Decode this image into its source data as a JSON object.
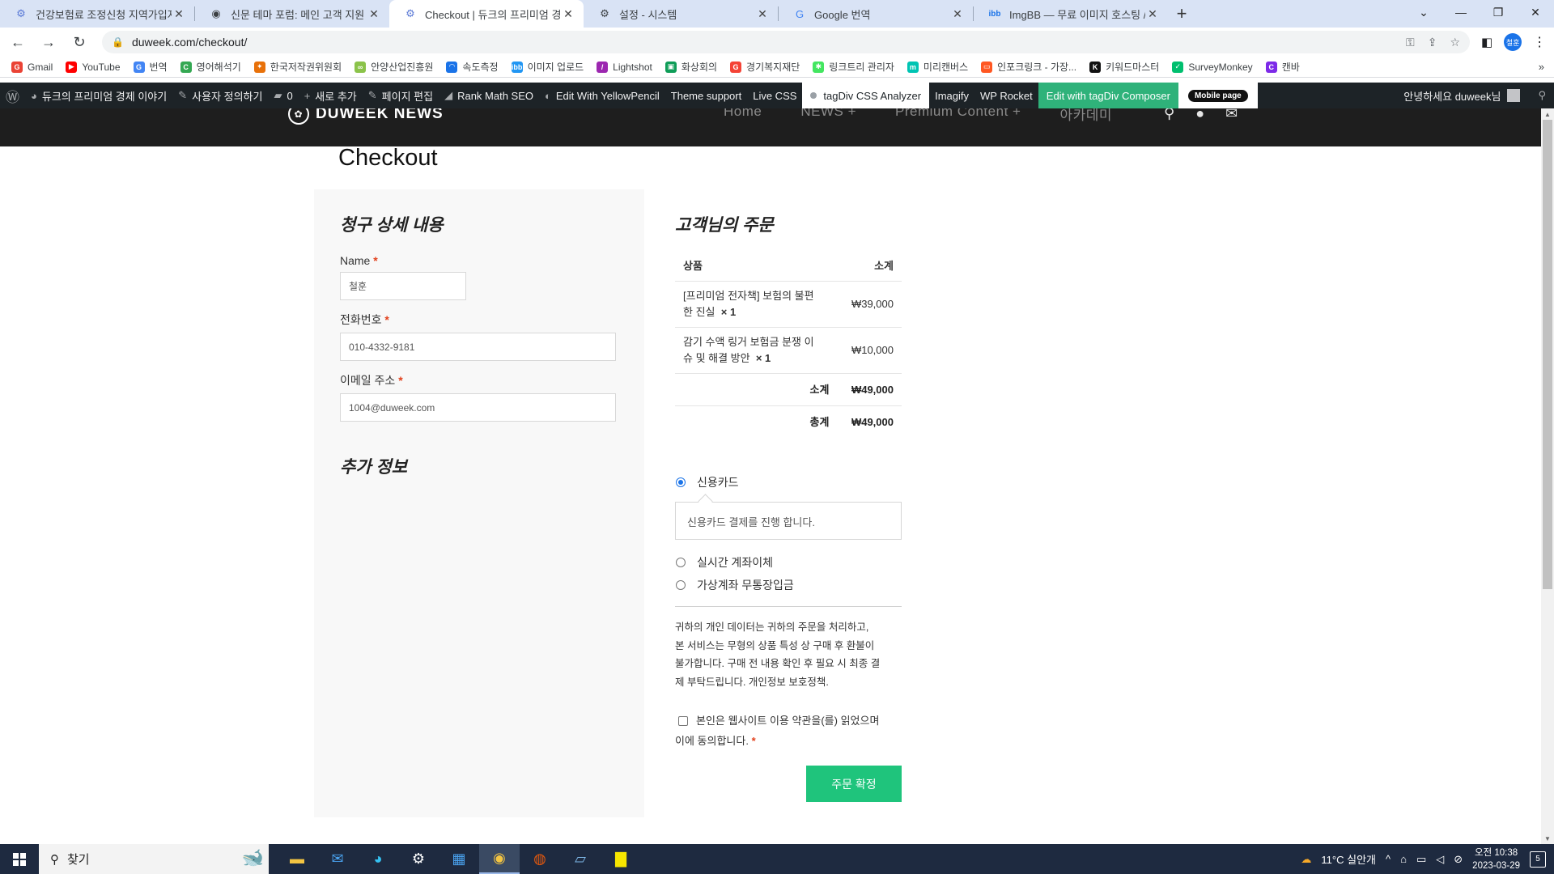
{
  "browser": {
    "tabs": [
      {
        "title": "건강보험료 조정신청 지역가입자",
        "icon": "gear-blue-icon",
        "active": false
      },
      {
        "title": "신문 테마 포럼: 메인 고객 지원",
        "icon": "eye-icon",
        "active": false
      },
      {
        "title": "Checkout | 듀크의 프리미엄 경제",
        "icon": "gear-blue-icon",
        "active": true
      },
      {
        "title": "설정 - 시스템",
        "icon": "gear-icon",
        "active": false
      },
      {
        "title": "Google 번역",
        "icon": "translate-icon",
        "active": false
      },
      {
        "title": "ImgBB — 무료 이미지 호스팅 /",
        "icon": "imgbb-icon",
        "active": false
      }
    ],
    "url": "duweek.com/checkout/",
    "profile_initials": "철훈",
    "bookmarks": [
      {
        "label": "Gmail",
        "color": "#ea4335",
        "glyph": "G"
      },
      {
        "label": "YouTube",
        "color": "#ff0000",
        "glyph": "▶"
      },
      {
        "label": "번역",
        "color": "#4285f4",
        "glyph": "G"
      },
      {
        "label": "영어해석기",
        "color": "#34a853",
        "glyph": "C"
      },
      {
        "label": "한국저작권위원회",
        "color": "#e8710a",
        "glyph": "✦"
      },
      {
        "label": "안양산업진흥원",
        "color": "#8bc34a",
        "glyph": "∞"
      },
      {
        "label": "속도측정",
        "color": "#1a73e8",
        "glyph": "◠"
      },
      {
        "label": "이미지 업로드",
        "color": "#2196f3",
        "glyph": "ibb"
      },
      {
        "label": "Lightshot",
        "color": "#9c27b0",
        "glyph": "/"
      },
      {
        "label": "화상회의",
        "color": "#0f9d58",
        "glyph": "▣"
      },
      {
        "label": "경기복지재단",
        "color": "#f44336",
        "glyph": "G"
      },
      {
        "label": "링크트리 관리자",
        "color": "#43e660",
        "glyph": "✱"
      },
      {
        "label": "미리캔버스",
        "color": "#00c4b3",
        "glyph": "m"
      },
      {
        "label": "인포크링크 - 가장...",
        "color": "#ff5722",
        "glyph": "▭"
      },
      {
        "label": "키워드마스터",
        "color": "#111111",
        "glyph": "K"
      },
      {
        "label": "SurveyMonkey",
        "color": "#00bf6f",
        "glyph": "✓"
      },
      {
        "label": "캔바",
        "color": "#7d2ae8",
        "glyph": "C"
      }
    ]
  },
  "adminbar": {
    "items": [
      {
        "label": "듀크의 프리미엄 경제 이야기",
        "icon": "dashboard-icon",
        "glyph": "◕"
      },
      {
        "label": "사용자 정의하기",
        "icon": "brush-icon",
        "glyph": "✎"
      },
      {
        "label": "0",
        "icon": "comment-icon",
        "glyph": "▰"
      },
      {
        "label": "새로 추가",
        "icon": "plus-icon",
        "glyph": "+"
      },
      {
        "label": "페이지 편집",
        "icon": "pencil-icon",
        "glyph": "✎"
      },
      {
        "label": "Rank Math SEO",
        "icon": "rankmath-icon",
        "glyph": "◢"
      },
      {
        "label": "Edit With YellowPencil",
        "icon": "yellowpencil-icon",
        "glyph": "◐"
      },
      {
        "label": "Theme support",
        "icon": "",
        "glyph": ""
      },
      {
        "label": "Live CSS",
        "icon": "",
        "glyph": ""
      }
    ],
    "tagdiv_analyzer": "tagDiv CSS Analyzer",
    "items2": [
      "Imagify",
      "WP Rocket"
    ],
    "compose": "Edit with tagDiv Composer",
    "mobile": "Mobile page",
    "greeting": "안녕하세요 duweek님"
  },
  "site": {
    "logo": "DUWEEK NEWS",
    "nav": [
      "Home",
      "NEWS  +",
      "Premium Content  +",
      "아카데미"
    ]
  },
  "checkout": {
    "title": "Checkout",
    "billing_heading": "청구 상세 내용",
    "fields": {
      "name_label": "Name",
      "name_value": "철훈",
      "phone_label": "전화번호",
      "phone_value": "010-4332-9181",
      "email_label": "이메일 주소",
      "email_value": "1004@duweek.com",
      "required_mark": "*"
    },
    "additional_heading": "추가 정보",
    "order_heading": "고객님의 주문",
    "table": {
      "col_product": "상품",
      "col_subtotal": "소계",
      "items": [
        {
          "name_line1": "[프리미엄 전자책] 보험의 불편",
          "name_line2": "한 진실",
          "qty": "× 1",
          "price": "₩39,000"
        },
        {
          "name_line1": "감기 수액 링거 보험금 분쟁 이",
          "name_line2": "슈 및 해결 방안",
          "qty": "× 1",
          "price": "₩10,000"
        }
      ],
      "subtotal_label": "소계",
      "subtotal_value": "₩49,000",
      "total_label": "총계",
      "total_value": "₩49,000"
    },
    "payment": {
      "options": [
        "신용카드",
        "실시간 계좌이체",
        "가상계좌 무통장입금"
      ],
      "selected": "신용카드",
      "card_note": "신용카드 결제를 진행 합니다."
    },
    "privacy_lines": [
      "귀하의 개인 데이터는 귀하의 주문을 처리하고,",
      "본 서비스는 무형의 상품 특성 상 구매 후 환불이",
      "불가합니다. 구매 전 내용 확인 후 필요 시 최종 결",
      "제 부탁드립니다. 개인정보 보호정책."
    ],
    "terms_line1": "본인은 웹사이트 이용 약관을(를) 읽었으며",
    "terms_line2": "이에 동의합니다.",
    "place_order": "주문 확정"
  },
  "taskbar": {
    "search_placeholder": "찾기",
    "weather": "11°C 실안개",
    "time": "오전 10:38",
    "date": "2023-03-29",
    "notifications": "5"
  }
}
